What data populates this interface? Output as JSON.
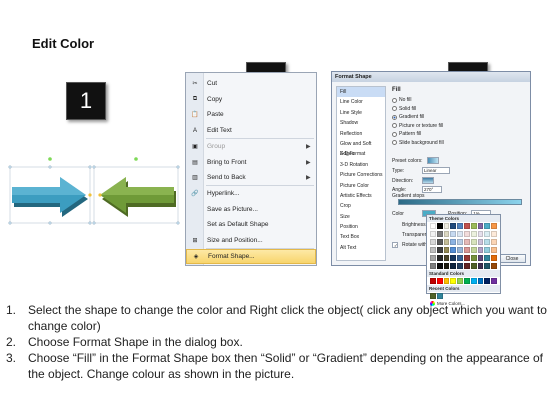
{
  "title": "Edit Color",
  "steps": [
    "1",
    "2",
    "3"
  ],
  "context_menu": {
    "items": [
      {
        "label": "Cut",
        "icon": "scissors-icon",
        "submenu": false,
        "disabled": false,
        "highlight": false
      },
      {
        "label": "Copy",
        "icon": "copy-icon",
        "submenu": false,
        "disabled": false,
        "highlight": false
      },
      {
        "label": "Paste",
        "icon": "paste-icon",
        "submenu": false,
        "disabled": false,
        "highlight": false
      },
      {
        "label": "Edit Text",
        "icon": "edit-text-icon",
        "submenu": false,
        "disabled": false,
        "highlight": false
      },
      {
        "label": "Group",
        "icon": "group-icon",
        "submenu": true,
        "disabled": true,
        "highlight": false
      },
      {
        "label": "Bring to Front",
        "icon": "bring-front-icon",
        "submenu": true,
        "disabled": false,
        "highlight": false
      },
      {
        "label": "Send to Back",
        "icon": "send-back-icon",
        "submenu": true,
        "disabled": false,
        "highlight": false
      },
      {
        "label": "Hyperlink...",
        "icon": "hyperlink-icon",
        "submenu": false,
        "disabled": false,
        "highlight": false
      },
      {
        "label": "Save as Picture...",
        "icon": "",
        "submenu": false,
        "disabled": false,
        "highlight": false
      },
      {
        "label": "Set as Default Shape",
        "icon": "",
        "submenu": false,
        "disabled": false,
        "highlight": false
      },
      {
        "label": "Size and Position...",
        "icon": "size-position-icon",
        "submenu": false,
        "disabled": false,
        "highlight": false
      },
      {
        "label": "Format Shape...",
        "icon": "format-shape-icon",
        "submenu": false,
        "disabled": false,
        "highlight": true
      }
    ]
  },
  "dialog": {
    "title": "Format Shape",
    "categories": [
      "Fill",
      "Line Color",
      "Line Style",
      "Shadow",
      "Reflection",
      "Glow and Soft Edges",
      "3-D Format",
      "3-D Rotation",
      "Picture Corrections",
      "Picture Color",
      "Artistic Effects",
      "Crop",
      "Size",
      "Position",
      "Text Box",
      "Alt Text"
    ],
    "fill_heading": "Fill",
    "fill_options": [
      {
        "label": "No fill",
        "selected": false
      },
      {
        "label": "Solid fill",
        "selected": false
      },
      {
        "label": "Gradient fill",
        "selected": true
      },
      {
        "label": "Picture or texture fill",
        "selected": false
      },
      {
        "label": "Pattern fill",
        "selected": false
      },
      {
        "label": "Slide background fill",
        "selected": false
      }
    ],
    "preset_colors_label": "Preset colors:",
    "type_label": "Type:",
    "type_value": "Linear",
    "direction_label": "Direction:",
    "angle_label": "Angle:",
    "angle_value": "270°",
    "gradient_stops_label": "Gradient stops",
    "color_label": "Color",
    "position_label": "Position:",
    "position_value": "1%",
    "brightness_label": "Brightness",
    "transparency_label": "Transparency",
    "rotate_label": "Rotate with shape",
    "close_label": "Close"
  },
  "picker": {
    "theme_label": "Theme Colors",
    "standard_label": "Standard Colors",
    "recent_label": "Recent Colors",
    "more_label": "More Colors...",
    "theme_rows": [
      [
        "#ffffff",
        "#000000",
        "#eeece1",
        "#1f497d",
        "#4f81bd",
        "#c0504d",
        "#9bbb59",
        "#8064a2",
        "#4bacc6",
        "#f79646"
      ],
      [
        "#f2f2f2",
        "#7f7f7f",
        "#ddd9c3",
        "#c6d9f0",
        "#dbe5f1",
        "#f2dcdb",
        "#ebf1dd",
        "#e5e0ec",
        "#dbeef3",
        "#fdeada"
      ],
      [
        "#d8d8d8",
        "#595959",
        "#c4bd97",
        "#8db3e2",
        "#b8cce4",
        "#e5b9b7",
        "#d7e3bc",
        "#ccc1d9",
        "#b7dde8",
        "#fbd5b5"
      ],
      [
        "#bfbfbf",
        "#3f3f3f",
        "#938953",
        "#548dd4",
        "#95b3d7",
        "#d99694",
        "#c3d69b",
        "#b2a2c7",
        "#92cddc",
        "#fac08f"
      ],
      [
        "#a5a5a5",
        "#262626",
        "#494429",
        "#17365d",
        "#366092",
        "#953734",
        "#76923c",
        "#5f497a",
        "#31859b",
        "#e36c09"
      ],
      [
        "#7f7f7f",
        "#0c0c0c",
        "#1d1b10",
        "#0f243e",
        "#244061",
        "#632423",
        "#4f6128",
        "#3f3151",
        "#205867",
        "#974806"
      ]
    ],
    "standard_row": [
      "#c00000",
      "#ff0000",
      "#ffc000",
      "#ffff00",
      "#92d050",
      "#00b050",
      "#00b0f0",
      "#0070c0",
      "#002060",
      "#7030a0"
    ],
    "recent_row": [
      "#4f6228",
      "#31849b"
    ]
  },
  "instructions": [
    {
      "num": "1.",
      "text": "Select the shape to change the color and Right click the object( click any object which you want to change color)"
    },
    {
      "num": "2.",
      "text": "Choose Format Shape in the dialog box."
    },
    {
      "num": "3.",
      "text": "Choose “Fill” in the Format Shape box then “Solid” or “Gradient” depending on the appearance of the object. Change colour as shown in the picture."
    }
  ],
  "colors": {
    "blue_arrow": "#3c9dc0",
    "green_arrow": "#6f9a38",
    "highlight": "#f8d56d"
  }
}
